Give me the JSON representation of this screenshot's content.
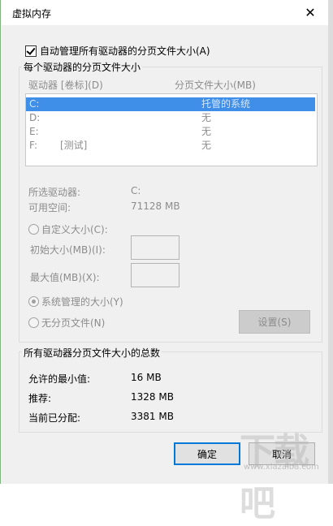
{
  "window": {
    "title": "虚拟内存",
    "close_glyph": "✕"
  },
  "auto_manage": {
    "label": "自动管理所有驱动器的分页文件大小(A)",
    "checked": true
  },
  "per_drive_group": {
    "title": "每个驱动器的分页文件大小",
    "col_drive": "驱动器 [卷标](D)",
    "col_size": "分页文件大小(MB)",
    "drives": [
      {
        "drive": "C:",
        "label": "",
        "size": "托管的系统",
        "selected": true
      },
      {
        "drive": "D:",
        "label": "",
        "size": "无",
        "selected": false
      },
      {
        "drive": "E:",
        "label": "",
        "size": "无",
        "selected": false
      },
      {
        "drive": "F:",
        "label": "[测试]",
        "size": "无",
        "selected": false
      }
    ],
    "selected_drive_label": "所选驱动器:",
    "selected_drive_value": "C:",
    "free_space_label": "可用空间:",
    "free_space_value": "71128 MB",
    "custom_size_label": "自定义大小(C):",
    "initial_size_label": "初始大小(MB)(I):",
    "max_size_label": "最大值(MB)(X):",
    "system_managed_label": "系统管理的大小(Y)",
    "no_paging_label": "无分页文件(N)",
    "set_button": "设置(S)"
  },
  "totals_group": {
    "title": "所有驱动器分页文件大小的总数",
    "min_label": "允许的最小值:",
    "min_value": "16 MB",
    "recommended_label": "推荐:",
    "recommended_value": "1328 MB",
    "allocated_label": "当前已分配:",
    "allocated_value": "3381 MB"
  },
  "buttons": {
    "ok": "确定",
    "cancel": "取消"
  },
  "watermark": {
    "text": "下载吧",
    "sub": "www.xiazaiba.com"
  }
}
